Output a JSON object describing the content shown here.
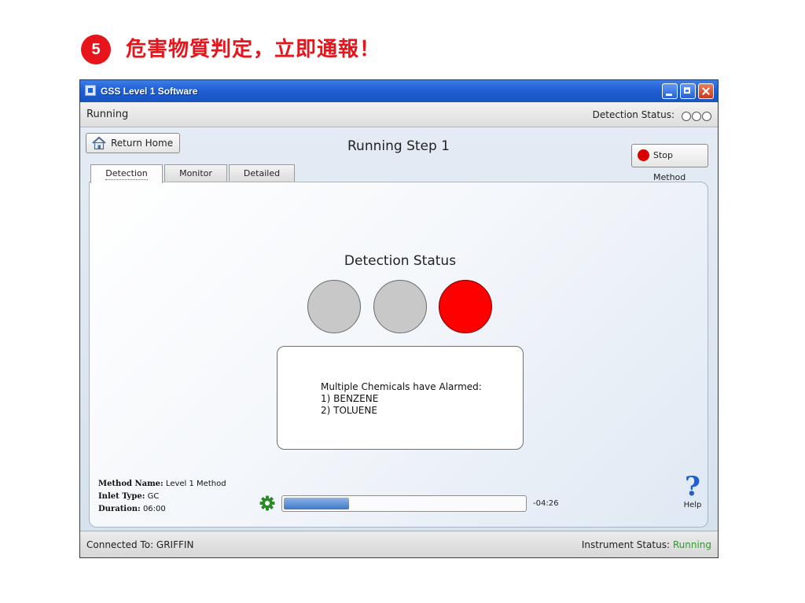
{
  "slide": {
    "step_number": "5",
    "title": "危害物質判定，立即通報！"
  },
  "window": {
    "title": "GSS Level 1 Software"
  },
  "top_status": {
    "state": "Running",
    "detection_label": "Detection Status:",
    "indicators": [
      "off",
      "off",
      "alarm"
    ]
  },
  "toolbar": {
    "return_home_label": "Return Home",
    "page_heading": "Running Step 1",
    "stop_method_label": "Stop Method"
  },
  "tabs": [
    {
      "label": "Detection",
      "selected": true
    },
    {
      "label": "Monitor",
      "selected": false
    },
    {
      "label": "Detailed",
      "selected": false
    }
  ],
  "detection": {
    "heading": "Detection Status",
    "lights": [
      "off",
      "off",
      "alarm"
    ],
    "message_lines": [
      "Multiple Chemicals have Alarmed:",
      "1) BENZENE",
      "2) TOLUENE"
    ]
  },
  "method": {
    "name_label": "Method Name:",
    "name_value": "Level 1 Method",
    "inlet_label": "Inlet Type:",
    "inlet_value": "GC",
    "duration_label": "Duration:",
    "duration_value": "06:00"
  },
  "progress": {
    "fraction": 0.27,
    "remaining": "-04:26"
  },
  "help": {
    "label": "Help"
  },
  "bottom_status": {
    "connected": "Connected To: GRIFFIN",
    "instrument_label": "Instrument Status:",
    "instrument_value": "Running"
  },
  "colors": {
    "accent_red": "#e8141b",
    "alarm_red": "#ff0000",
    "light_off": "#c8c8c8",
    "running_green": "#2f9a2f",
    "titlebar_blue": "#1f5fd3"
  }
}
